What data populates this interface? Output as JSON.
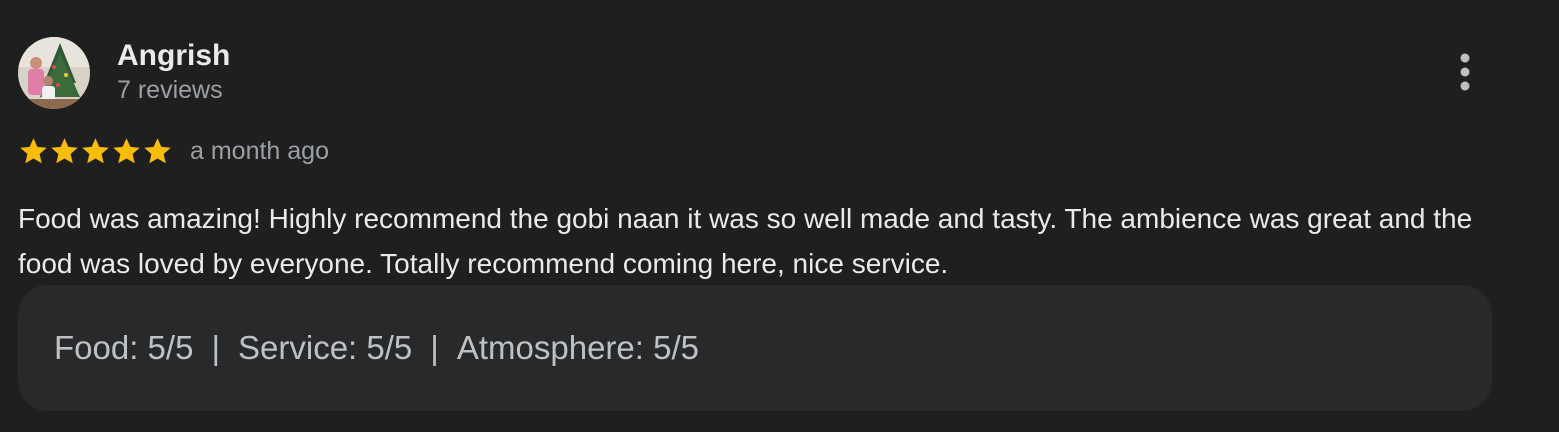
{
  "reviewer": {
    "name": "Angrish",
    "review_count": "7 reviews",
    "avatar_icon": "user-photo-avatar"
  },
  "rating": {
    "stars": 5,
    "max_stars": 5,
    "star_color": "#fbbc04",
    "time": "a month ago"
  },
  "review": {
    "text": "Food was amazing! Highly recommend the gobi naan it was so well made and tasty. The ambience was great and the food was loved by everyone. Totally recommend coming here, nice service."
  },
  "sub_ratings": {
    "food": "Food: 5/5",
    "separator": "|",
    "service": "Service: 5/5",
    "atmosphere": "Atmosphere: 5/5"
  },
  "menu": {
    "icon": "more-vert-icon"
  },
  "colors": {
    "background": "#1f1f1f",
    "card": "#28292b",
    "primary_text": "#e8eaed",
    "secondary_text": "#9aa0a6"
  }
}
